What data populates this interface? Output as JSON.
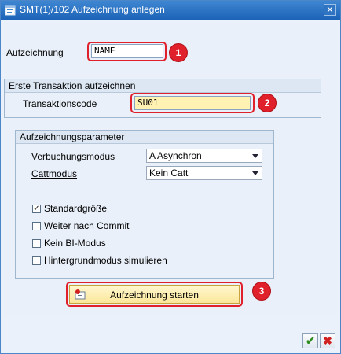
{
  "window": {
    "title": "SMT(1)/102 Aufzeichnung anlegen",
    "close_glyph": "✕"
  },
  "aufzeichnung": {
    "label": "Aufzeichnung",
    "value": "NAME",
    "marker": "1"
  },
  "transaction_group": {
    "title": "Erste Transaktion aufzeichnen",
    "label": "Transaktionscode",
    "value": "SU01",
    "marker": "2"
  },
  "params_group": {
    "title": "Aufzeichnungsparameter",
    "verbuchungsmodus": {
      "label": "Verbuchungsmodus",
      "value": "A Asynchron"
    },
    "cattmodus": {
      "label": "Cattmodus",
      "value": "Kein Catt"
    },
    "checkboxes": [
      {
        "label": "Standardgröße",
        "checked": true,
        "mark": "✓"
      },
      {
        "label": "Weiter nach Commit",
        "checked": false,
        "mark": ""
      },
      {
        "label": "Kein BI-Modus",
        "checked": false,
        "mark": ""
      },
      {
        "label": "Hintergrundmodus simulieren",
        "checked": false,
        "mark": ""
      }
    ]
  },
  "start_button": {
    "label": "Aufzeichnung starten",
    "marker": "3"
  },
  "footer": {
    "ok_glyph": "✔",
    "cancel_glyph": "✖"
  },
  "colors": {
    "callout": "#e0202a",
    "title_bar": "#1c63b7",
    "active_field": "#fff2b3"
  }
}
